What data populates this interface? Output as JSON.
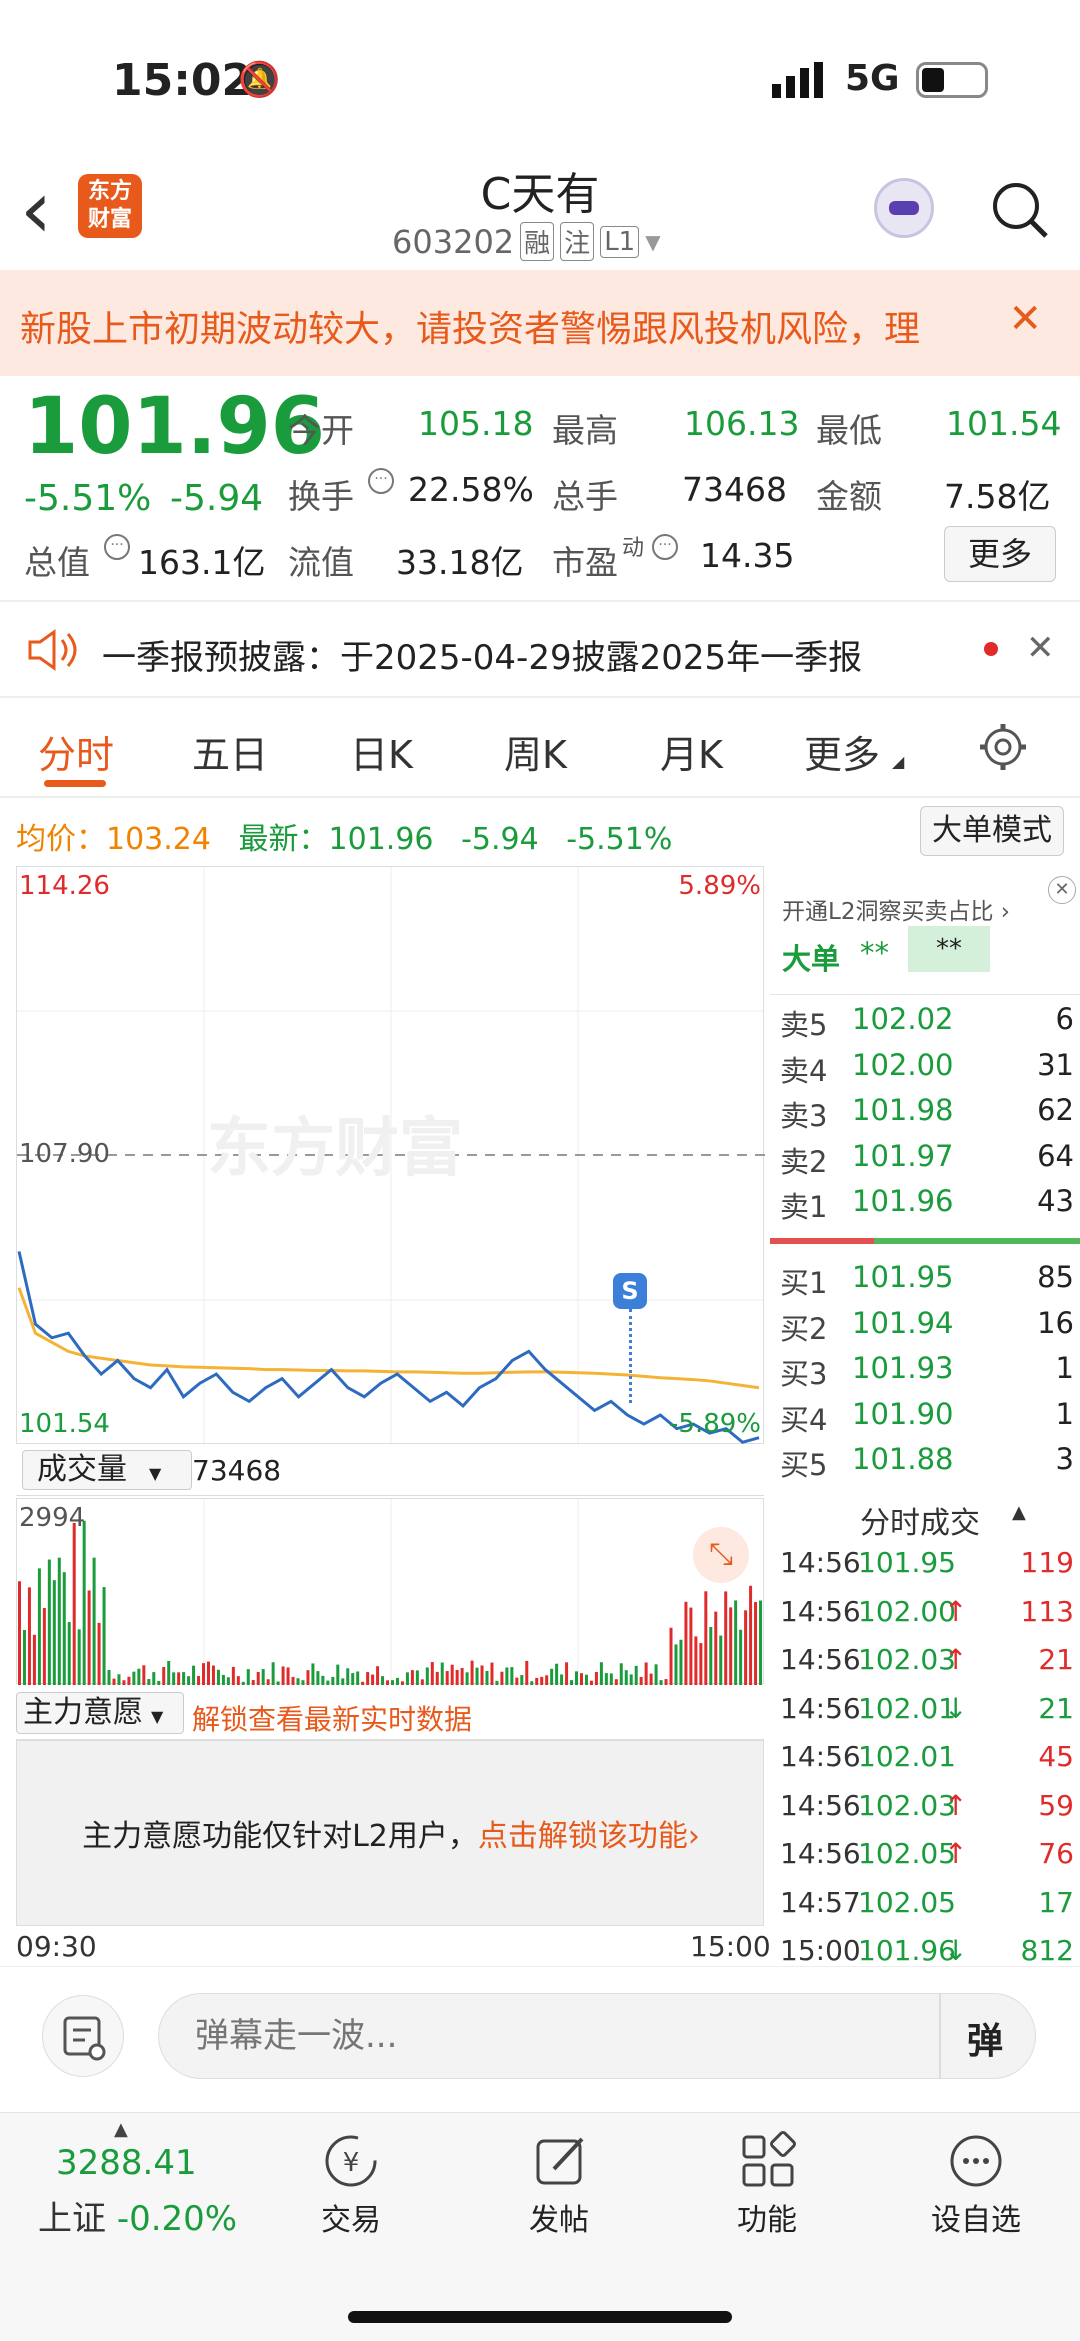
{
  "status": {
    "time": "15:02",
    "network": "5G"
  },
  "header": {
    "back": "‹",
    "logo_l1": "东方",
    "logo_l2": "财富",
    "title": "C天有",
    "code": "603202",
    "tag1": "融",
    "tag2": "注",
    "tag3": "L1"
  },
  "banner": {
    "text": "新股上市初期波动较大，请投资者警惕跟风投机风险，理",
    "close": "✕"
  },
  "quote": {
    "price": "101.96",
    "pct": "-5.51%",
    "chg": "-5.94",
    "open_l": "今开",
    "open": "105.18",
    "high_l": "最高",
    "high": "106.13",
    "low_l": "最低",
    "low": "101.54",
    "turn_l": "换手",
    "turn": "22.58%",
    "vol_l": "总手",
    "vol": "73468",
    "amt_l": "金额",
    "amt": "7.58亿",
    "mcap_l": "总值",
    "mcap": "163.1亿",
    "fmcap_l": "流值",
    "fmcap": "33.18亿",
    "pe_l": "市盈",
    "pe_sup": "动",
    "pe": "14.35",
    "more": "更多"
  },
  "notice": {
    "text": "一季报预披露：于2025-04-29披露2025年一季报",
    "close": "✕"
  },
  "tabs": [
    "分时",
    "五日",
    "日K",
    "周K",
    "月K",
    "更多"
  ],
  "chart_info": {
    "avg_l": "均价：",
    "avg": "103.24",
    "new_l": "最新：",
    "new": "101.96",
    "chg": "-5.94",
    "pct": "-5.51%",
    "mode": "大单模式"
  },
  "chart_labels": {
    "top_price": "114.26",
    "top_pct": "5.89%",
    "mid": "107.90",
    "bot_price": "101.54",
    "bot_pct": "-5.89%",
    "watermark": "东方财富",
    "vol_l": "成交量",
    "vol": "73468",
    "vol_max": "2994",
    "zl_l": "主力意愿",
    "zl_link": "解锁查看最新实时数据",
    "zl_msg": "主力意愿功能仅针对L2用户，",
    "zl_unlock": "点击解锁该功能",
    "t_start": "09:30",
    "t_end": "15:00"
  },
  "chart_data": {
    "type": "line",
    "ylim": [
      101.54,
      114.26
    ],
    "series": [
      {
        "values": [
          105.8,
          104.2,
          103.9,
          104.0,
          103.5,
          103.1,
          103.4,
          103.0,
          102.8,
          103.2,
          102.6,
          102.9,
          103.1,
          102.7,
          102.5,
          102.8,
          103.0,
          102.6,
          102.9,
          103.2,
          102.8,
          102.6,
          102.9,
          103.1,
          102.8,
          102.5,
          102.7,
          102.4,
          102.8,
          103.0,
          103.4,
          103.6,
          103.2,
          102.9,
          102.6,
          102.3,
          102.5,
          102.2,
          102.0,
          102.2,
          101.9,
          102.0,
          101.8,
          101.9,
          101.6,
          101.7
        ]
      },
      {
        "values": [
          105.0,
          104.0,
          103.8,
          103.6,
          103.5,
          103.45,
          103.4,
          103.35,
          103.3,
          103.28,
          103.26,
          103.25,
          103.24,
          103.23,
          103.22,
          103.2,
          103.2,
          103.19,
          103.18,
          103.18,
          103.17,
          103.17,
          103.16,
          103.15,
          103.15,
          103.14,
          103.13,
          103.12,
          103.12,
          103.13,
          103.14,
          103.15,
          103.15,
          103.14,
          103.13,
          103.12,
          103.1,
          103.08,
          103.05,
          103.02,
          103.0,
          102.98,
          102.95,
          102.9,
          102.85,
          102.8
        ]
      }
    ]
  },
  "orderbook": {
    "header": "开通L2洞察买卖占比",
    "big_l": "大单",
    "big_v1": "**",
    "big_v2": "**",
    "sell": [
      {
        "l": "卖5",
        "p": "102.02",
        "v": "6"
      },
      {
        "l": "卖4",
        "p": "102.00",
        "v": "31"
      },
      {
        "l": "卖3",
        "p": "101.98",
        "v": "62"
      },
      {
        "l": "卖2",
        "p": "101.97",
        "v": "64"
      },
      {
        "l": "卖1",
        "p": "101.96",
        "v": "43"
      }
    ],
    "buy": [
      {
        "l": "买1",
        "p": "101.95",
        "v": "85"
      },
      {
        "l": "买2",
        "p": "101.94",
        "v": "16"
      },
      {
        "l": "买3",
        "p": "101.93",
        "v": "1"
      },
      {
        "l": "买4",
        "p": "101.90",
        "v": "1"
      },
      {
        "l": "买5",
        "p": "101.88",
        "v": "3"
      }
    ],
    "ticks_title": "分时成交",
    "ticks": [
      {
        "t": "14:56",
        "p": "101.95",
        "v": "119",
        "a": ""
      },
      {
        "t": "14:56",
        "p": "102.00",
        "v": "113",
        "a": "↑"
      },
      {
        "t": "14:56",
        "p": "102.03",
        "v": "21",
        "a": "↑"
      },
      {
        "t": "14:56",
        "p": "102.01",
        "v": "21",
        "a": "↓"
      },
      {
        "t": "14:56",
        "p": "102.01",
        "v": "45",
        "a": ""
      },
      {
        "t": "14:56",
        "p": "102.03",
        "v": "59",
        "a": "↑"
      },
      {
        "t": "14:56",
        "p": "102.05",
        "v": "76",
        "a": "↑"
      },
      {
        "t": "14:57",
        "p": "102.05",
        "v": "17",
        "a": ""
      },
      {
        "t": "15:00",
        "p": "101.96",
        "v": "812",
        "a": "↓"
      }
    ]
  },
  "comment": {
    "placeholder": "弹幕走一波...",
    "danmu": "弹"
  },
  "bottom": {
    "index_val": "3288.41",
    "index_name": "上证",
    "index_pct": "-0.20%",
    "items": [
      "交易",
      "发帖",
      "功能",
      "设自选"
    ]
  }
}
